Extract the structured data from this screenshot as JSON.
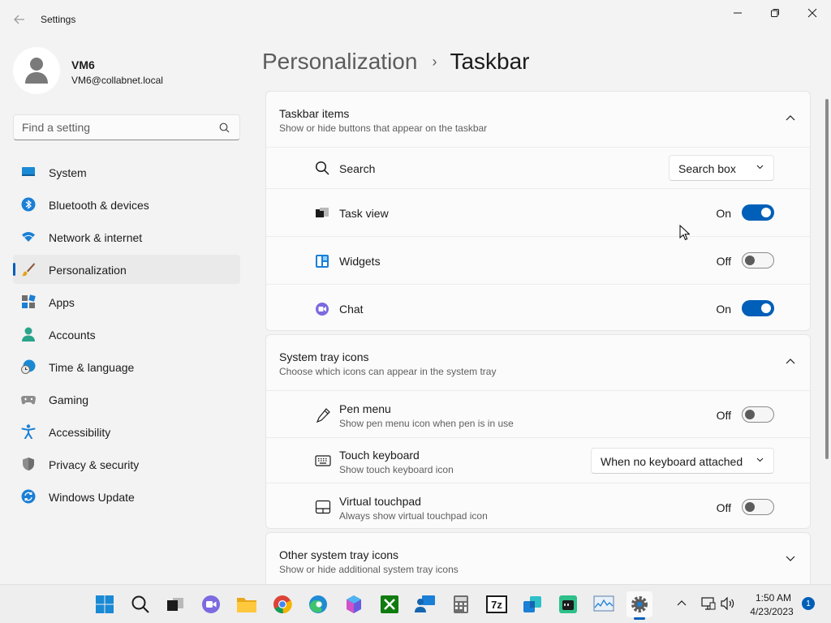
{
  "window": {
    "title": "Settings",
    "back_icon": "back-arrow-icon",
    "controls": [
      "minimize-icon",
      "maximize-icon",
      "close-icon"
    ]
  },
  "profile": {
    "name": "VM6",
    "email": "VM6@collabnet.local"
  },
  "search": {
    "placeholder": "Find a setting"
  },
  "sidebar": {
    "items": [
      {
        "label": "System",
        "icon": "system-icon"
      },
      {
        "label": "Bluetooth & devices",
        "icon": "bluetooth-icon"
      },
      {
        "label": "Network & internet",
        "icon": "wifi-icon"
      },
      {
        "label": "Personalization",
        "icon": "brush-icon",
        "active": true
      },
      {
        "label": "Apps",
        "icon": "apps-icon"
      },
      {
        "label": "Accounts",
        "icon": "account-icon"
      },
      {
        "label": "Time & language",
        "icon": "globe-clock-icon"
      },
      {
        "label": "Gaming",
        "icon": "gamepad-icon"
      },
      {
        "label": "Accessibility",
        "icon": "accessibility-icon"
      },
      {
        "label": "Privacy & security",
        "icon": "shield-icon"
      },
      {
        "label": "Windows Update",
        "icon": "update-icon"
      }
    ]
  },
  "breadcrumb": {
    "parent": "Personalization",
    "separator": "›",
    "current": "Taskbar"
  },
  "taskbar_items": {
    "title": "Taskbar items",
    "subtitle": "Show or hide buttons that appear on the taskbar",
    "rows": [
      {
        "label": "Search",
        "icon": "search-icon",
        "control": "dropdown",
        "value": "Search box"
      },
      {
        "label": "Task view",
        "icon": "task-view-icon",
        "control": "toggle",
        "state": "On"
      },
      {
        "label": "Widgets",
        "icon": "widgets-icon",
        "control": "toggle",
        "state": "Off"
      },
      {
        "label": "Chat",
        "icon": "chat-icon",
        "control": "toggle",
        "state": "On"
      }
    ]
  },
  "system_tray": {
    "title": "System tray icons",
    "subtitle": "Choose which icons can appear in the system tray",
    "rows": [
      {
        "label": "Pen menu",
        "sub": "Show pen menu icon when pen is in use",
        "icon": "pen-icon",
        "control": "toggle",
        "state": "Off"
      },
      {
        "label": "Touch keyboard",
        "sub": "Show touch keyboard icon",
        "icon": "keyboard-icon",
        "control": "dropdown",
        "value": "When no keyboard attached"
      },
      {
        "label": "Virtual touchpad",
        "sub": "Always show virtual touchpad icon",
        "icon": "touchpad-icon",
        "control": "toggle",
        "state": "Off"
      }
    ]
  },
  "other_tray": {
    "title": "Other system tray icons",
    "subtitle": "Show or hide additional system tray icons"
  },
  "taskbar": {
    "apps": [
      "start-icon",
      "search-icon",
      "task-view-icon",
      "chat-icon",
      "file-explorer-icon",
      "chrome-icon",
      "edge-icon",
      "copilot-icon",
      "xbox-icon",
      "remote-desktop-icon",
      "calculator-icon",
      "7zip-icon",
      "hyperv-icon",
      "terminal-icon",
      "resource-monitor-icon",
      "settings-icon"
    ],
    "time": "1:50 AM",
    "date": "4/23/2023",
    "notifications": "1"
  },
  "colors": {
    "accent": "#005fb8",
    "background": "#f3f3f3",
    "card": "#fbfbfb"
  }
}
